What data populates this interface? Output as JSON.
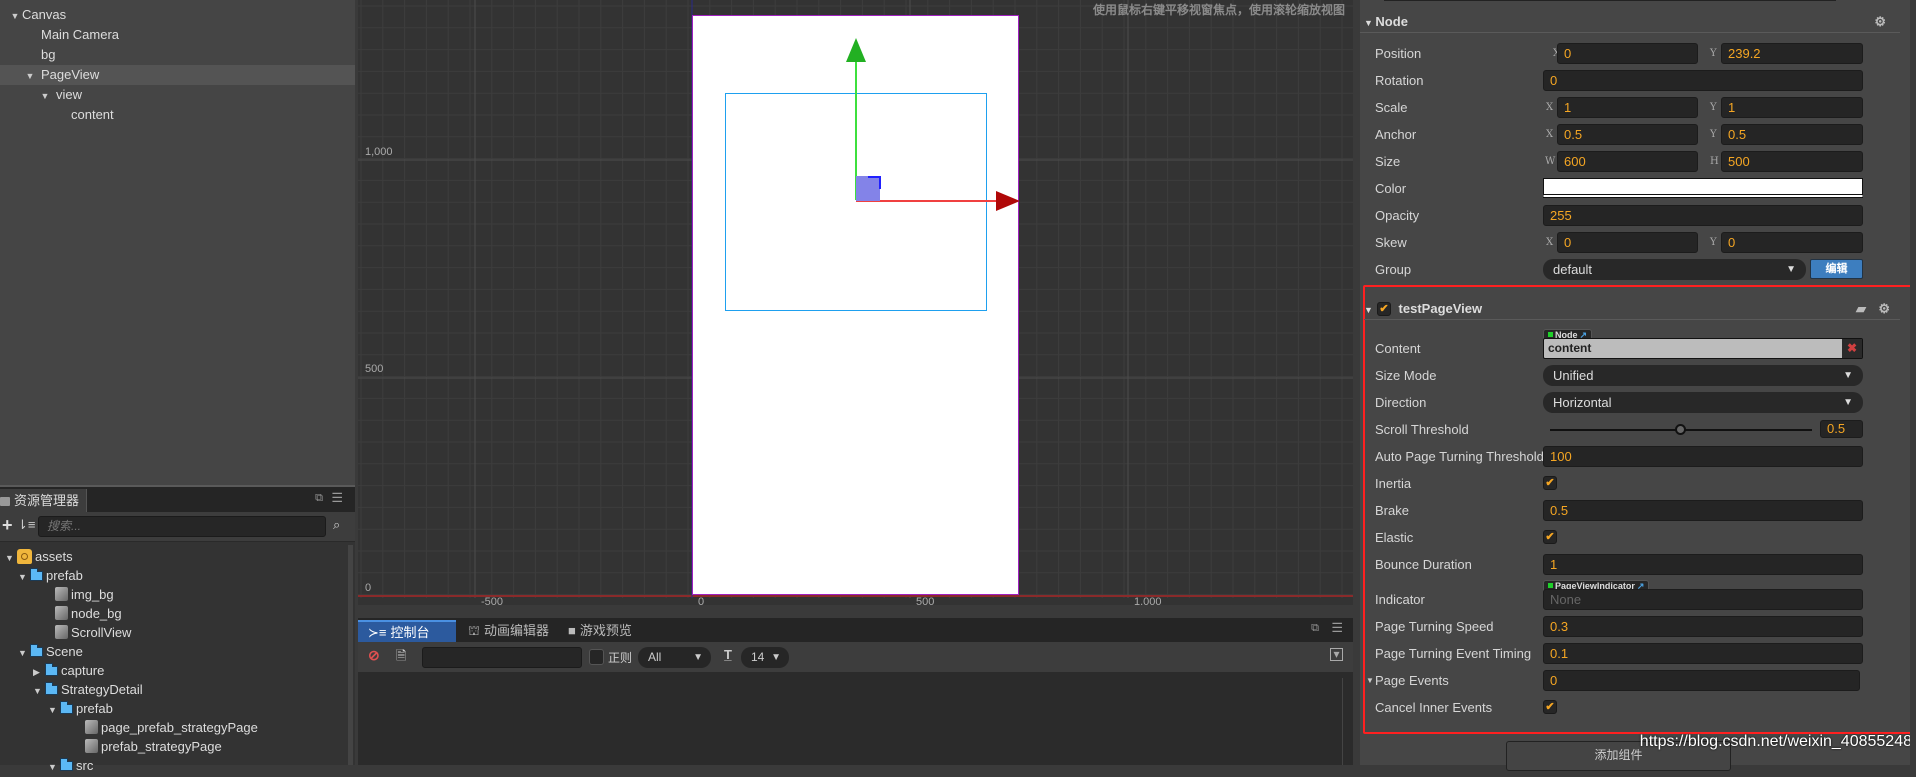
{
  "hierarchy": {
    "items": [
      {
        "label": "Canvas",
        "expanded": true
      },
      {
        "label": "Main Camera"
      },
      {
        "label": "bg"
      },
      {
        "label": "PageView",
        "expanded": true,
        "selected": true
      },
      {
        "label": "view",
        "expanded": true
      },
      {
        "label": "content"
      }
    ]
  },
  "assets": {
    "tab_label": "资源管理器",
    "search_placeholder": "搜索...",
    "items": [
      {
        "label": "assets",
        "type": "root",
        "expanded": true
      },
      {
        "label": "prefab",
        "type": "folder",
        "expanded": true
      },
      {
        "label": "img_bg",
        "type": "prefab"
      },
      {
        "label": "node_bg",
        "type": "prefab"
      },
      {
        "label": "ScrollView",
        "type": "prefab"
      },
      {
        "label": "Scene",
        "type": "folder",
        "expanded": true
      },
      {
        "label": "capture",
        "type": "folder",
        "expanded": false
      },
      {
        "label": "StrategyDetail",
        "type": "folder",
        "expanded": true
      },
      {
        "label": "prefab",
        "type": "folder",
        "expanded": true
      },
      {
        "label": "page_prefab_strategyPage",
        "type": "prefab"
      },
      {
        "label": "prefab_strategyPage",
        "type": "prefab"
      },
      {
        "label": "src",
        "type": "folder",
        "expanded": true
      }
    ]
  },
  "scene": {
    "hint": "使用鼠标右键平移视窗焦点，使用滚轮缩放视图",
    "y_labels": [
      "1,000",
      "500",
      "0"
    ],
    "x_labels": [
      "-500",
      "0",
      "500",
      "1,000"
    ]
  },
  "console": {
    "tabs": [
      "控制台",
      "动画编辑器",
      "游戏预览"
    ],
    "regex_label": "正则",
    "filter_value": "All",
    "font_size_value": "14"
  },
  "inspector": {
    "node_section": "Node",
    "position": {
      "label": "Position",
      "x": "0",
      "y": "239.2"
    },
    "rotation": {
      "label": "Rotation",
      "value": "0"
    },
    "scale": {
      "label": "Scale",
      "x": "1",
      "y": "1"
    },
    "anchor": {
      "label": "Anchor",
      "x": "0.5",
      "y": "0.5"
    },
    "size": {
      "label": "Size",
      "w": "600",
      "h": "500"
    },
    "color": {
      "label": "Color",
      "value": "#ffffff"
    },
    "opacity": {
      "label": "Opacity",
      "value": "255"
    },
    "skew": {
      "label": "Skew",
      "x": "0",
      "y": "0"
    },
    "group": {
      "label": "Group",
      "value": "default",
      "edit_label": "编辑"
    },
    "axis_labels": {
      "x": "X",
      "y": "Y",
      "w": "W",
      "h": "H"
    },
    "component": {
      "name": "testPageView",
      "enabled": true,
      "content": {
        "label": "Content",
        "type_tag": "Node",
        "value": "content"
      },
      "size_mode": {
        "label": "Size Mode",
        "value": "Unified"
      },
      "direction": {
        "label": "Direction",
        "value": "Horizontal"
      },
      "scroll_threshold": {
        "label": "Scroll Threshold",
        "value": "0.5",
        "fraction": 0.5
      },
      "auto_page_turning_threshold": {
        "label": "Auto Page Turning Threshold",
        "value": "100"
      },
      "inertia": {
        "label": "Inertia",
        "checked": true
      },
      "brake": {
        "label": "Brake",
        "value": "0.5"
      },
      "elastic": {
        "label": "Elastic",
        "checked": true
      },
      "bounce_duration": {
        "label": "Bounce Duration",
        "value": "1"
      },
      "indicator": {
        "label": "Indicator",
        "type_tag": "PageViewIndicator",
        "value": "None"
      },
      "page_turning_speed": {
        "label": "Page Turning Speed",
        "value": "0.3"
      },
      "page_turning_event_timing": {
        "label": "Page Turning Event Timing",
        "value": "0.1"
      },
      "page_events": {
        "label": "Page Events",
        "value": "0"
      },
      "cancel_inner_events": {
        "label": "Cancel Inner Events",
        "checked": true
      }
    },
    "add_component_label": "添加组件"
  },
  "watermark": "https://blog.csdn.net/weixin_40855248",
  "colors": {
    "accent": "#f5a623",
    "highlight": "#ff2020",
    "edit_button": "#3d7ebf"
  }
}
